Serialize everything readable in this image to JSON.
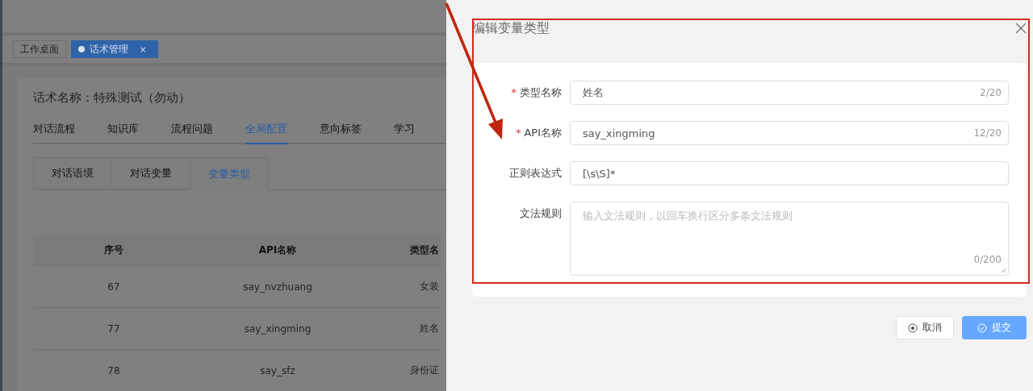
{
  "workspace_tabs": [
    {
      "label": "工作桌面",
      "selected": false
    },
    {
      "label": "话术管理",
      "selected": true,
      "close_glyph": "×"
    }
  ],
  "script_title": "话术名称：特殊测试（勿动）",
  "nav_tabs": [
    {
      "label": "对话流程",
      "selected": false
    },
    {
      "label": "知识库",
      "selected": false
    },
    {
      "label": "流程问题",
      "selected": false
    },
    {
      "label": "全局配置",
      "selected": true
    },
    {
      "label": "意向标签",
      "selected": false
    },
    {
      "label": "学习",
      "selected": false
    }
  ],
  "sub_tabs": [
    {
      "label": "对话语境",
      "selected": false
    },
    {
      "label": "对话变量",
      "selected": false
    },
    {
      "label": "变量类型",
      "selected": true
    }
  ],
  "table": {
    "columns": [
      "序号",
      "API名称",
      "类型名"
    ],
    "rows": [
      [
        "67",
        "say_nvzhuang",
        "女装"
      ],
      [
        "77",
        "say_xingming",
        "姓名"
      ],
      [
        "78",
        "say_sfz",
        "身份证"
      ]
    ]
  },
  "drawer": {
    "title": "编辑变量类型",
    "fields": [
      {
        "kind": "input",
        "label": "类型名称",
        "required_mark": "*",
        "value": "姓名",
        "counter": "2/20"
      },
      {
        "kind": "input",
        "label": "API名称",
        "required_mark": "*",
        "value": "say_xingming",
        "counter": "12/20"
      },
      {
        "kind": "input",
        "label": "正则表达式",
        "value": "[\\s\\S]*"
      },
      {
        "kind": "textarea",
        "label": "文法规则",
        "placeholder": "输入文法规则，以回车换行区分多条文法规则",
        "counter": "0/200"
      }
    ],
    "buttons": [
      {
        "kind": "cancel",
        "label": "取消"
      },
      {
        "kind": "submit",
        "label": "提交"
      }
    ]
  }
}
